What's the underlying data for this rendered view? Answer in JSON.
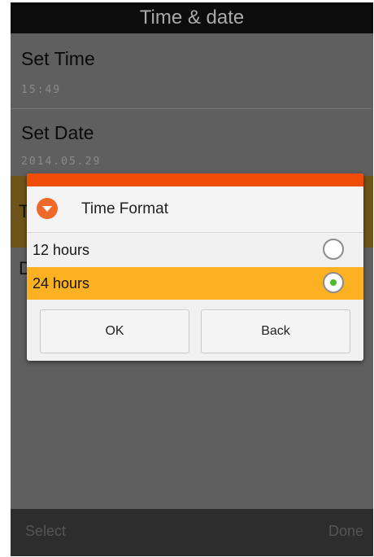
{
  "title_bar": {
    "title": "Time & date"
  },
  "settings": [
    {
      "title": "Set Time",
      "value": "15:49"
    },
    {
      "title": "Set Date",
      "value": "2014.05.29"
    }
  ],
  "bottom_bar": {
    "left_label": "Select",
    "right_label": "Done"
  },
  "dialog": {
    "title": "Time Format",
    "accent_color": "#ef4b09",
    "highlight_color": "#fbb122",
    "options": [
      {
        "label": "12 hours",
        "selected": false
      },
      {
        "label": "24 hours",
        "selected": true
      }
    ],
    "ok_label": "OK",
    "back_label": "Back"
  }
}
